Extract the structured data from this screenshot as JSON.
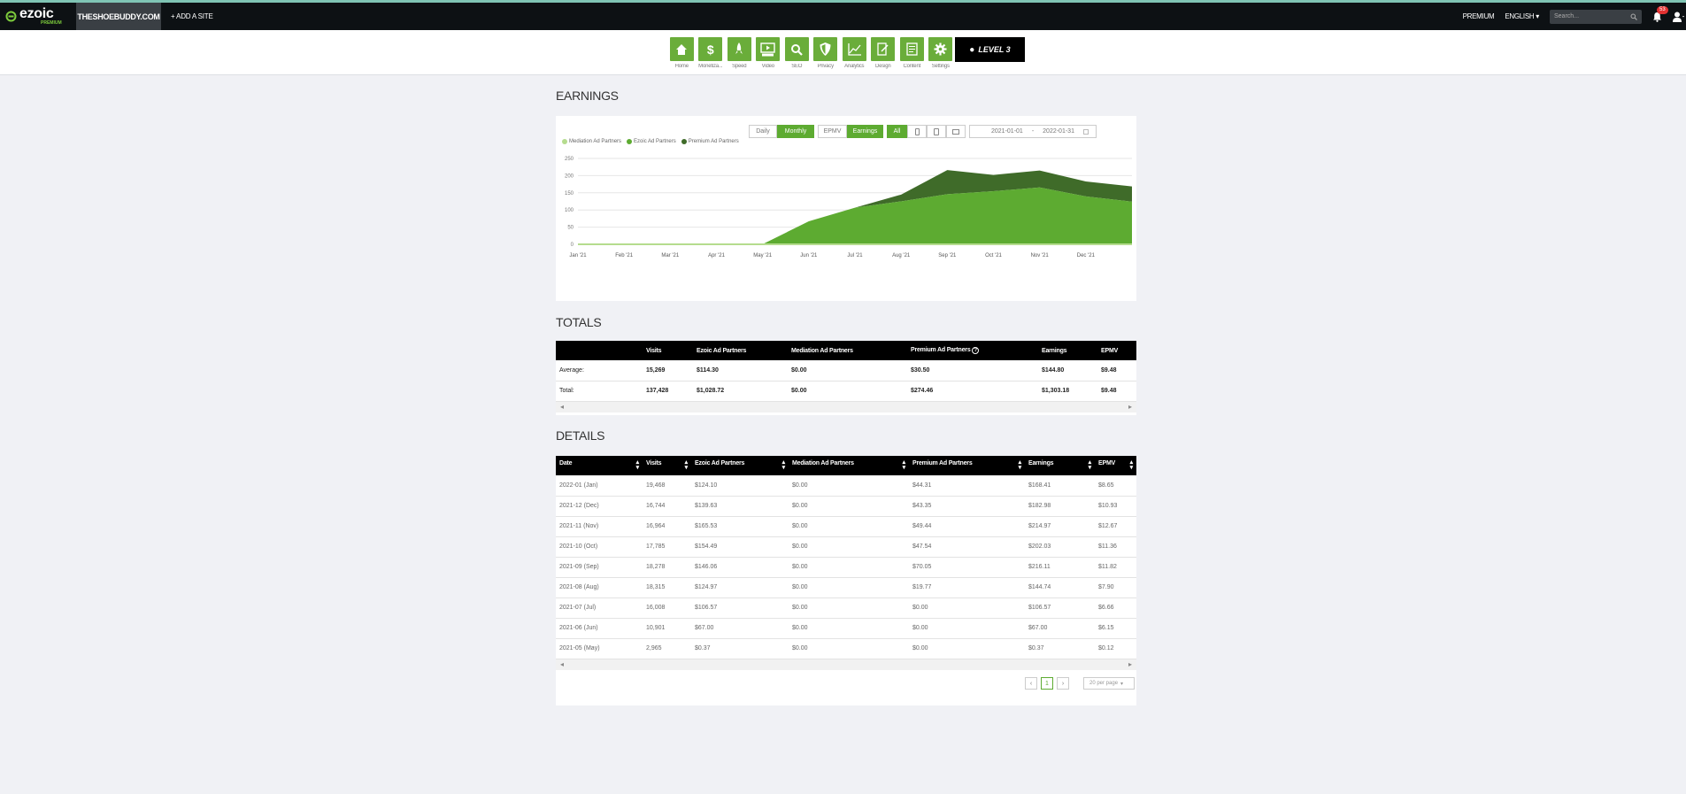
{
  "header": {
    "logo": "ezoic",
    "logo_sub": "PREMIUM",
    "site_name": "THESHOEBUDDY.COM",
    "add_site": "+ ADD A SITE",
    "premium": "PREMIUM",
    "language": "ENGLISH",
    "search_placeholder": "Search...",
    "notifications": "53"
  },
  "nav": {
    "items": [
      {
        "label": "Home",
        "icon": "home-icon"
      },
      {
        "label": "Monetiza...",
        "icon": "dollar-icon"
      },
      {
        "label": "Speed",
        "icon": "rocket-icon"
      },
      {
        "label": "Video",
        "icon": "video-icon"
      },
      {
        "label": "SEO",
        "icon": "search-icon"
      },
      {
        "label": "Privacy",
        "icon": "shield-icon"
      },
      {
        "label": "Analytics",
        "icon": "analytics-icon"
      },
      {
        "label": "Design",
        "icon": "design-icon"
      },
      {
        "label": "Content",
        "icon": "content-icon"
      },
      {
        "label": "Settings",
        "icon": "gear-icon"
      }
    ],
    "level": "LEVEL 3"
  },
  "earnings": {
    "title": "EARNINGS",
    "controls": {
      "daily": "Daily",
      "monthly": "Monthly",
      "epmv": "EPMV",
      "earnings": "Earnings",
      "all": "All"
    },
    "date_from": "2021-01-01",
    "date_sep": "-",
    "date_to": "2022-01-31",
    "legend": [
      "Mediation Ad Partners",
      "Ezoic Ad Partners",
      "Premium Ad Partners"
    ],
    "colors": {
      "mediation": "#b5dc8e",
      "ezoic": "#5dab31",
      "premium": "#3f6b29"
    }
  },
  "chart_data": {
    "type": "area",
    "x": [
      "Jan '21",
      "Feb '21",
      "Mar '21",
      "Apr '21",
      "May '21",
      "Jun '21",
      "Jul '21",
      "Aug '21",
      "Sep '21",
      "Oct '21",
      "Nov '21",
      "Dec '21",
      "Jan '22"
    ],
    "x_tick_labels": [
      "Jan '21",
      "Feb '21",
      "Mar '21",
      "Apr '21",
      "May '21",
      "Jun '21",
      "Jul '21",
      "Aug '21",
      "Sep '21",
      "Oct '21",
      "Nov '21",
      "Dec '21"
    ],
    "stacked": true,
    "series": [
      {
        "name": "Mediation Ad Partners",
        "values": [
          0,
          0,
          0,
          0,
          0,
          0,
          0,
          0,
          0,
          0,
          0,
          0,
          0
        ]
      },
      {
        "name": "Ezoic Ad Partners",
        "values": [
          0,
          0,
          0,
          0,
          0.37,
          67.0,
          106.57,
          124.97,
          146.06,
          154.49,
          165.53,
          139.63,
          124.1
        ]
      },
      {
        "name": "Premium Ad Partners",
        "values": [
          0,
          0,
          0,
          0,
          0,
          0,
          0,
          19.77,
          70.05,
          47.54,
          49.44,
          43.35,
          44.31
        ]
      }
    ],
    "yticks": [
      0,
      50,
      100,
      150,
      200,
      250
    ],
    "ylim": [
      0,
      250
    ],
    "grid": true,
    "legend": "top-left"
  },
  "totals": {
    "title": "TOTALS",
    "headers": [
      "",
      "Visits",
      "Ezoic Ad Partners",
      "Mediation Ad Partners",
      "Premium Ad Partners",
      "Earnings",
      "EPMV"
    ],
    "rows": [
      [
        "Average:",
        "15,269",
        "$114.30",
        "$0.00",
        "$30.50",
        "$144.80",
        "$9.48"
      ],
      [
        "Total:",
        "137,428",
        "$1,028.72",
        "$0.00",
        "$274.46",
        "$1,303.18",
        "$9.48"
      ]
    ]
  },
  "details": {
    "title": "DETAILS",
    "headers": [
      "Date",
      "Visits",
      "Ezoic Ad Partners",
      "Mediation Ad Partners",
      "Premium Ad Partners",
      "Earnings",
      "EPMV"
    ],
    "rows": [
      [
        "2022-01 (Jan)",
        "19,468",
        "$124.10",
        "$0.00",
        "$44.31",
        "$168.41",
        "$8.65"
      ],
      [
        "2021-12 (Dec)",
        "16,744",
        "$139.63",
        "$0.00",
        "$43.35",
        "$182.98",
        "$10.93"
      ],
      [
        "2021-11 (Nov)",
        "16,964",
        "$165.53",
        "$0.00",
        "$49.44",
        "$214.97",
        "$12.67"
      ],
      [
        "2021-10 (Oct)",
        "17,785",
        "$154.49",
        "$0.00",
        "$47.54",
        "$202.03",
        "$11.36"
      ],
      [
        "2021-09 (Sep)",
        "18,278",
        "$146.06",
        "$0.00",
        "$70.05",
        "$216.11",
        "$11.82"
      ],
      [
        "2021-08 (Aug)",
        "18,315",
        "$124.97",
        "$0.00",
        "$19.77",
        "$144.74",
        "$7.90"
      ],
      [
        "2021-07 (Jul)",
        "16,008",
        "$106.57",
        "$0.00",
        "$0.00",
        "$106.57",
        "$6.66"
      ],
      [
        "2021-06 (Jun)",
        "10,901",
        "$67.00",
        "$0.00",
        "$0.00",
        "$67.00",
        "$6.15"
      ],
      [
        "2021-05 (May)",
        "2,965",
        "$0.37",
        "$0.00",
        "$0.00",
        "$0.37",
        "$0.12"
      ]
    ],
    "pagination": {
      "prev": "‹",
      "page": "1",
      "next": "›",
      "per_page": "20 per page"
    }
  }
}
